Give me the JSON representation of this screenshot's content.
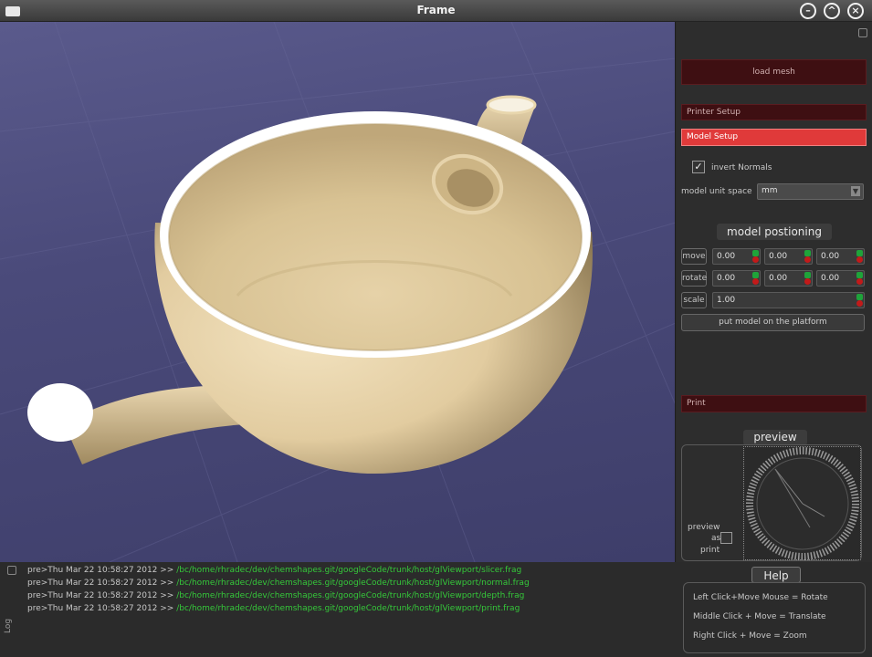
{
  "window": {
    "title": "Frame"
  },
  "panel": {
    "load_mesh": "load mesh",
    "printer_setup": "Printer Setup",
    "model_setup": "Model Setup",
    "invert_normals": {
      "label": "invert Normals",
      "checked": true,
      "mark": "✓"
    },
    "model_unit_space": {
      "label": "model unit space",
      "value": "mm"
    },
    "model_positioning": {
      "title": "model postioning",
      "move": {
        "label": "move",
        "values": [
          "0.00",
          "0.00",
          "0.00"
        ]
      },
      "rotate": {
        "label": "rotate",
        "values": [
          "0.00",
          "0.00",
          "0.00"
        ]
      },
      "scale": {
        "label": "scale",
        "value": "1.00"
      },
      "put_on_platform": "put model on the platform"
    },
    "print": "Print",
    "preview": {
      "title": "preview",
      "label_line1": "preview",
      "label_line2": "as",
      "label_line3": "print"
    }
  },
  "log": {
    "label": "Log",
    "lines": [
      {
        "prefix": "pre>Thu Mar 22 10:58:27 2012 >> ",
        "path": "/bc/home/rhradec/dev/chemshapes.git/googleCode/trunk/host/glViewport/slicer.frag"
      },
      {
        "prefix": "pre>Thu Mar 22 10:58:27 2012 >> ",
        "path": "/bc/home/rhradec/dev/chemshapes.git/googleCode/trunk/host/glViewport/normal.frag"
      },
      {
        "prefix": "pre>Thu Mar 22 10:58:27 2012 >> ",
        "path": "/bc/home/rhradec/dev/chemshapes.git/googleCode/trunk/host/glViewport/depth.frag"
      },
      {
        "prefix": "pre>Thu Mar 22 10:58:27 2012 >> ",
        "path": "/bc/home/rhradec/dev/chemshapes.git/googleCode/trunk/host/glViewport/print.frag"
      }
    ]
  },
  "help": {
    "title": "Help",
    "lines": [
      "Left Click+Move Mouse = Rotate",
      "Middle Click + Move = Translate",
      "Right Click + Move = Zoom"
    ]
  },
  "colors": {
    "accent_red": "#e03a3a",
    "dark_red": "#3e0f12",
    "log_path_green": "#35c83a",
    "model": "#e9d6b0",
    "viewport_bg": "#4a4a7a"
  }
}
